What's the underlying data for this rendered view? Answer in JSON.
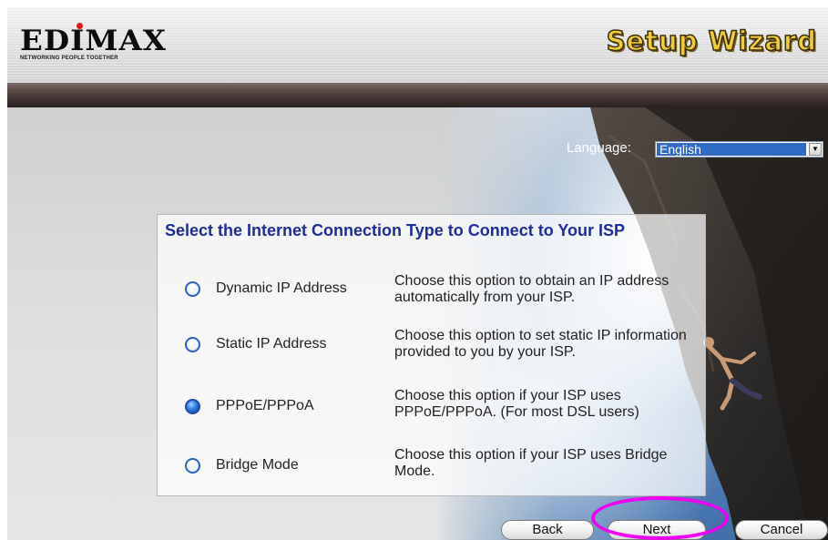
{
  "header": {
    "logo_text": "EDIMAX",
    "logo_tagline": "NETWORKING PEOPLE TOGETHER",
    "title": "Setup Wizard"
  },
  "language": {
    "label": "Language:",
    "selected": "English"
  },
  "panel": {
    "title": "Select the Internet Connection Type to Connect to Your ISP",
    "options": [
      {
        "label": "Dynamic IP Address",
        "description": "Choose this option to obtain an IP address automatically from your ISP.",
        "selected": false
      },
      {
        "label": "Static IP Address",
        "description": "Choose this option to set static IP information provided to you by your ISP.",
        "selected": false
      },
      {
        "label": "PPPoE/PPPoA",
        "description": "Choose this option if your ISP uses PPPoE/PPPoA. (For most DSL users)",
        "selected": true
      },
      {
        "label": "Bridge Mode",
        "description": "Choose this option if your ISP uses Bridge Mode.",
        "selected": false
      }
    ]
  },
  "buttons": {
    "back": "Back",
    "next": "Next",
    "cancel": "Cancel"
  },
  "colors": {
    "title_blue": "#1d2d9a",
    "highlight": "#f000f0",
    "wizard_title": "#f1cb3a"
  }
}
